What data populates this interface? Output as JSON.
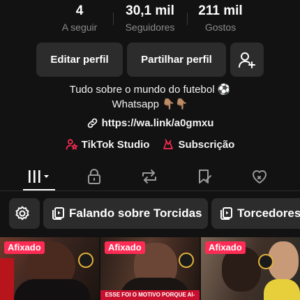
{
  "stats": [
    {
      "value": "4",
      "label": "A seguir"
    },
    {
      "value": "30,1 mil",
      "label": "Seguidores"
    },
    {
      "value": "211 mil",
      "label": "Gostos"
    }
  ],
  "actions": {
    "edit_label": "Editar perfil",
    "share_label": "Partilhar perfil",
    "add_friend_icon": "add-user-icon"
  },
  "bio": {
    "line1": "Tudo sobre o mundo do futebol ⚽",
    "line2": "Whatsapp 👇🏽👇🏽"
  },
  "link": {
    "text": "https://wa.link/a0gmxu",
    "icon": "link-icon"
  },
  "tools": {
    "studio_label": "TikTok Studio",
    "subscription_label": "Subscrição"
  },
  "tabs": [
    {
      "name": "videos",
      "icon": "grid-icon",
      "active": true
    },
    {
      "name": "private",
      "icon": "lock-icon"
    },
    {
      "name": "reposts",
      "icon": "repost-icon"
    },
    {
      "name": "saved",
      "icon": "bookmark-icon"
    },
    {
      "name": "liked",
      "icon": "heart-icon"
    }
  ],
  "playlists": {
    "items": [
      "Falando sobre Torcidas",
      "Torcedores"
    ]
  },
  "videos": [
    {
      "badge": "Afixado",
      "caption": ""
    },
    {
      "badge": "Afixado",
      "caption": "ESSE FOI O MOTIVO PORQUE AI-"
    },
    {
      "badge": "Afixado",
      "caption": ""
    }
  ],
  "colors": {
    "background": "#121212",
    "accent": "#fe2c55",
    "button": "#2c2c2c",
    "muted_text": "#8a8a8a"
  }
}
